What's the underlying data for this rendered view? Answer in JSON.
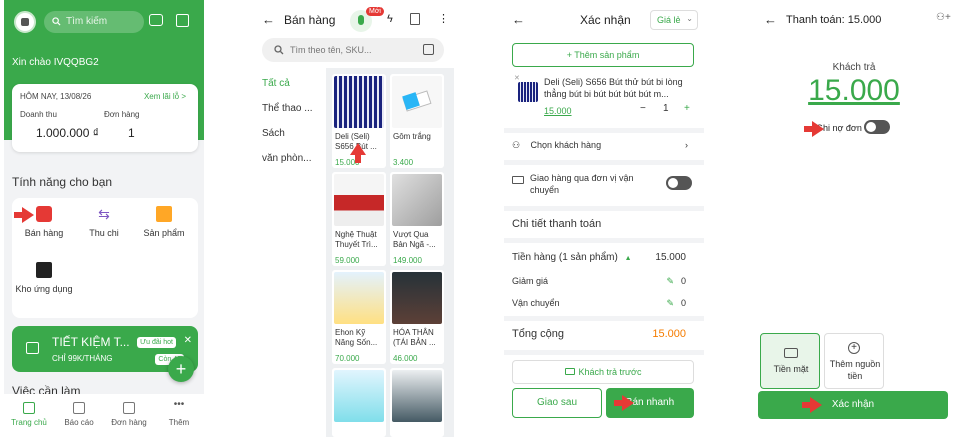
{
  "screen1": {
    "search_placeholder": "Tìm kiếm",
    "greeting": "Xin chào IVQQBG2",
    "today_label": "HÔM NAY, 13/08/26",
    "see_report": "Xem lãi lỗ >",
    "revenue_label": "Doanh thu",
    "orders_label": "Đơn hàng",
    "revenue_value": "1.000.000 ₫",
    "orders_value": "1",
    "features_title": "Tính năng cho bạn",
    "features": [
      {
        "label": "Bán hàng"
      },
      {
        "label": "Thu chi"
      },
      {
        "label": "Sản phẩm"
      },
      {
        "label": "Kho ứng dụng"
      }
    ],
    "promo_title": "TIẾT KIỆM T...",
    "promo_badge": "Ưu đãi hot",
    "promo_sub": "CHỈ 99K/THÁNG",
    "promo_badge2": "Còn 48",
    "need_title": "Việc cần làm",
    "nav": [
      "Trang chủ",
      "Báo cáo",
      "Đơn hàng",
      "Thêm"
    ]
  },
  "screen2": {
    "title": "Bán hàng",
    "new_badge": "Mới",
    "search_placeholder": "Tìm theo tên, SKU...",
    "categories": [
      "Tất cả",
      "Thể thao ...",
      "Sách",
      "văn phòn..."
    ],
    "products": [
      {
        "name": "Deli (Seli) S656 Bút ...",
        "price": "15.000"
      },
      {
        "name": "Gôm trắng",
        "price": "3.400"
      },
      {
        "name": "Nghệ Thuật Thuyết Trì...",
        "price": "59.000"
      },
      {
        "name": "Vượt Qua Bản Ngã -...",
        "price": "149.000"
      },
      {
        "name": "Ehon Kỹ Năng Sốn...",
        "price": "70.000"
      },
      {
        "name": "HÓA THÂN (TÁI BẢN ...",
        "price": "46.000"
      }
    ],
    "colors": {
      "accent": "#3aa94b"
    }
  },
  "screen3": {
    "title": "Xác nhận",
    "price_type": "Giá lẻ",
    "add_product": "+ Thêm sản phẩm",
    "item_name": "Deli (Seli) S656 Bút thử bút bi lòng thẳng bút bi bút bút bút bút m...",
    "item_price": "15.000",
    "item_qty": "1",
    "choose_customer": "Chọn khách hàng",
    "shipping_label": "Giao hàng qua đơn vị vận chuyển",
    "details_title": "Chi tiết thanh toán",
    "subtotal_label": "Tiền hàng (1 sản phẩm)",
    "subtotal_value": "15.000",
    "discount_label": "Giảm giá",
    "discount_value": "0",
    "shipping_fee_label": "Vận chuyển",
    "shipping_fee_value": "0",
    "total_label": "Tổng cộng",
    "total_value": "15.000",
    "prepay_label": "Khách trả trước",
    "later_label": "Giao sau",
    "quick_sell_label": "Bán nhanh"
  },
  "screen4": {
    "title": "Thanh toán: 15.000",
    "customer_pays_label": "Khách trả",
    "amount": "15.000",
    "debt_label": "Ghi nợ đơn",
    "cash_label": "Tiền mặt",
    "add_source_label": "Thêm nguồn tiền",
    "confirm_label": "Xác nhận"
  }
}
